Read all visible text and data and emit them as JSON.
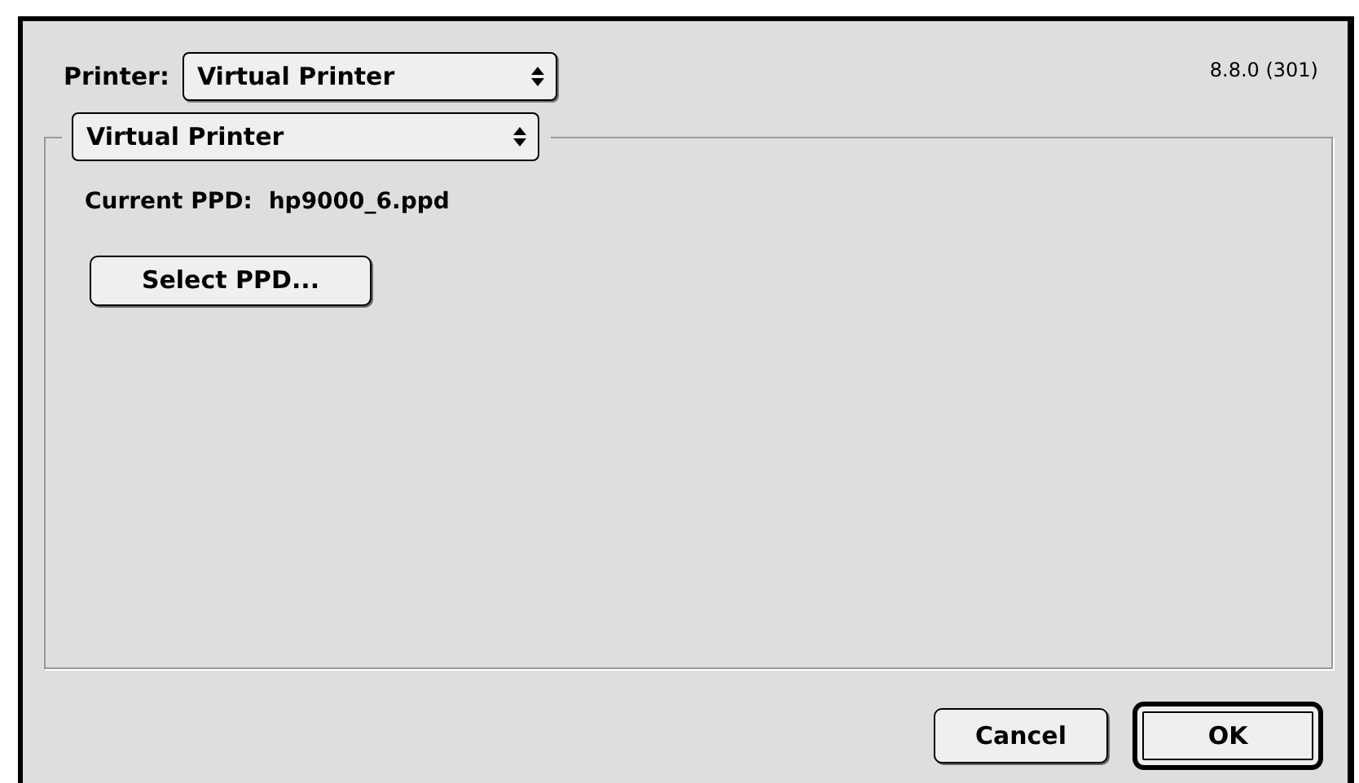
{
  "printer": {
    "label": "Printer:",
    "value": "Virtual Printer"
  },
  "version": "8.8.0 (301)",
  "panel": {
    "popup": "Virtual Printer",
    "current_ppd_label": "Current PPD:",
    "current_ppd": "hp9000_6.ppd",
    "select_button": "Select PPD..."
  },
  "buttons": [
    {
      "label": "Cancel",
      "default": false
    },
    {
      "label": "OK",
      "default": true
    }
  ]
}
